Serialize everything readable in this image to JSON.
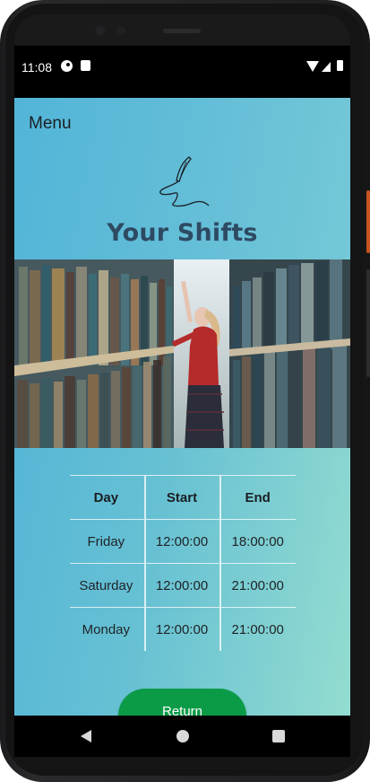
{
  "status_bar": {
    "time": "11:08"
  },
  "menu": {
    "label": "Menu"
  },
  "header": {
    "title": "Your Shifts"
  },
  "table": {
    "columns": [
      "Day",
      "Start",
      "End"
    ],
    "rows": [
      {
        "day": "Friday",
        "start": "12:00:00",
        "end": "18:00:00"
      },
      {
        "day": "Saturday",
        "start": "12:00:00",
        "end": "21:00:00"
      },
      {
        "day": "Monday",
        "start": "12:00:00",
        "end": "21:00:00"
      }
    ]
  },
  "return_button": {
    "label": "Return"
  },
  "colors": {
    "accent": "#0b9b47",
    "title": "#2e4a63"
  },
  "icons": [
    "quill-logo-icon",
    "back-icon",
    "home-icon",
    "recents-icon"
  ]
}
